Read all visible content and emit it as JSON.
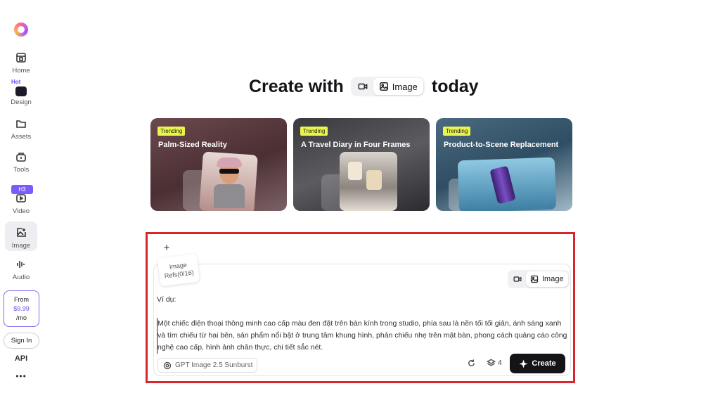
{
  "sidebar": {
    "items": [
      {
        "label": "Home",
        "icon": "home-icon"
      },
      {
        "label": "Design",
        "icon": "design-icon",
        "badge": "Hot"
      },
      {
        "label": "Assets",
        "icon": "folder-icon"
      },
      {
        "label": "Tools",
        "icon": "tools-icon"
      },
      {
        "label": "Video",
        "icon": "video-icon",
        "badge": "H3"
      },
      {
        "label": "Image",
        "icon": "image-edit-icon",
        "active": true
      },
      {
        "label": "Audio",
        "icon": "audio-icon"
      }
    ],
    "pricing": {
      "from": "From",
      "price": "$9.99",
      "per": "/mo"
    },
    "sign_in": "Sign In",
    "api": "API",
    "more": "•••"
  },
  "headline": {
    "prefix": "Create with",
    "mode_image": "Image",
    "suffix": "today"
  },
  "cards": [
    {
      "badge": "Trending",
      "title": "Palm-Sized Reality"
    },
    {
      "badge": "Trending",
      "title": "A Travel Diary in Four Frames"
    },
    {
      "badge": "Trending",
      "title": "Product-to-Scene Replacement"
    }
  ],
  "prompt": {
    "plus": "+",
    "refs_line1": "Image",
    "refs_line2": "Refs(0/16)",
    "mode_image": "Image",
    "label": "Ví dụ:",
    "text": "Một chiếc điện thoại thông minh cao cấp màu đen đặt trên bàn kính trong studio, phía sau là nền tối tối giản, ánh sáng xanh và tím chiếu từ hai bên, sản phẩm nổi bật ở trung tâm khung hình, phản chiếu nhẹ trên mặt bàn, phong cách quảng cáo công nghệ cao cấp, hình ảnh chân thực, chi tiết sắc nét.",
    "model": "GPT Image 2.5 Sunburst",
    "count": "4",
    "create_label": "Create"
  },
  "colors": {
    "accent": "#6b4cf0",
    "highlight_border": "#d8262c",
    "trending_badge": "#e9f54a",
    "create_bg": "#131318"
  }
}
